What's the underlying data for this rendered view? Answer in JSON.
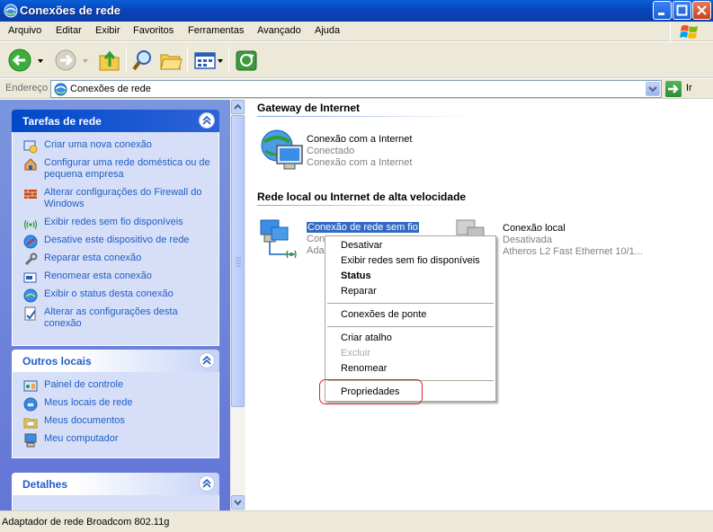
{
  "window": {
    "title": "Conexões de rede",
    "colors": {
      "titlebar": "#0a4fc8",
      "accent": "#316ac5",
      "close": "#c8411c"
    }
  },
  "menu": [
    "Arquivo",
    "Editar",
    "Exibir",
    "Favoritos",
    "Ferramentas",
    "Avançado",
    "Ajuda"
  ],
  "toolbar": {
    "buttons": [
      "back-icon",
      "forward-icon",
      "up-folder-icon",
      "search-icon",
      "folders-icon",
      "views-icon",
      "network-sync-icon"
    ]
  },
  "address": {
    "label": "Endereço",
    "value": "Conexões de rede",
    "go_label": "Ir"
  },
  "sidebar": {
    "network_tasks": {
      "title": "Tarefas de rede",
      "items": [
        "Criar uma nova conexão",
        "Configurar uma rede doméstica ou de pequena empresa",
        "Alterar configurações do Firewall do Windows",
        "Exibir redes sem fio disponíveis",
        "Desative este dispositivo de rede",
        "Reparar esta conexão",
        "Renomear esta conexão",
        "Exibir o status desta conexão",
        "Alterar as configurações desta conexão"
      ]
    },
    "other_places": {
      "title": "Outros locais",
      "items": [
        "Painel de controle",
        "Meus locais de rede",
        "Meus documentos",
        "Meu computador"
      ]
    },
    "details": {
      "title": "Detalhes"
    }
  },
  "content": {
    "gateway_group": "Gateway de Internet",
    "internet_conn": {
      "name": "Conexão com a Internet",
      "status": "Conectado",
      "type": "Conexão com a Internet"
    },
    "lan_group": "Rede local ou Internet de alta velocidade",
    "wireless_conn": {
      "name": "Conexão de rede sem fio",
      "status_partial": "Con",
      "device_partial": "Ada"
    },
    "local_conn": {
      "name": "Conexão local",
      "status": "Desativada",
      "device": "Atheros L2 Fast Ethernet 10/1..."
    }
  },
  "context_menu": {
    "items": [
      "Desativar",
      "Exibir redes sem fio disponíveis",
      "Status",
      "Reparar",
      "Conexões de ponte",
      "Criar atalho",
      "Excluir",
      "Renomear",
      "Propriedades"
    ]
  },
  "status_bar": {
    "text": "Adaptador de rede Broadcom 802.11g"
  }
}
